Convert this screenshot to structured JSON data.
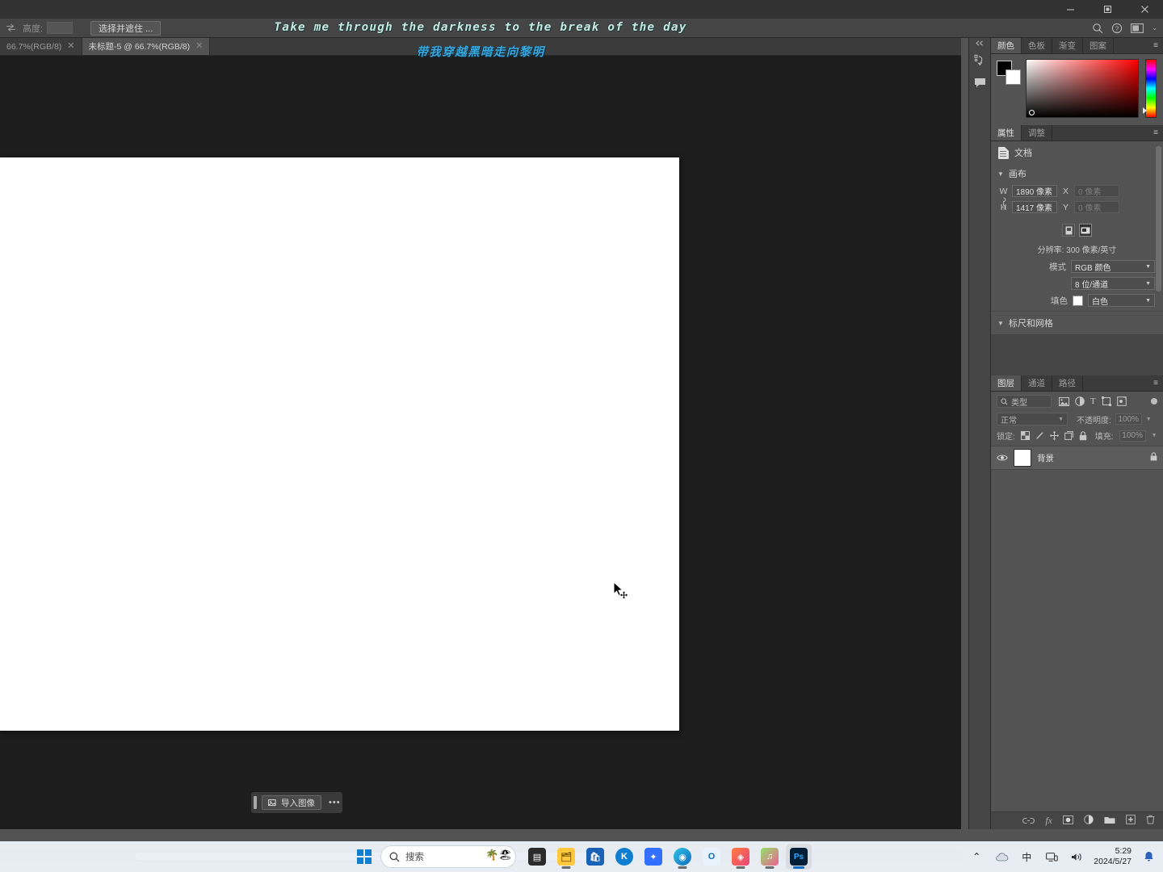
{
  "window": {
    "minimize": "–",
    "restore": "❐",
    "close": "✕"
  },
  "options_bar": {
    "swap_icon": "swap-arrows-icon",
    "height_label": "高度:",
    "height_value": "",
    "select_and_mask": "选择并遮住 ...",
    "search_icon": "search-icon",
    "help_icon": "help-icon",
    "workspace_icon": "workspace-icon",
    "chevron": "⌄"
  },
  "lyrics": {
    "english": "Take me through the darkness to the break of the day",
    "chinese": "带我穿越黑暗走向黎明"
  },
  "tabs": [
    {
      "label": "66.7%(RGB/8)",
      "close": "✕",
      "active": false
    },
    {
      "label": "未标题-5 @ 66.7%(RGB/8)",
      "close": "✕",
      "active": true
    }
  ],
  "canvas": {
    "import_button": "导入图像",
    "import_more": "•••",
    "import_icon": "import-image-icon"
  },
  "rail": {
    "collapse": "◀◀",
    "icons": [
      "history-icon",
      "comment-icon"
    ]
  },
  "color_panel": {
    "tabs": [
      "颜色",
      "色板",
      "渐变",
      "图案"
    ],
    "active_tab": "颜色",
    "menu": "≡",
    "foreground": "#000000",
    "background": "#ffffff"
  },
  "properties_panel": {
    "tabs": [
      "属性",
      "调整"
    ],
    "active_tab": "属性",
    "menu": "≡",
    "doc_label": "文档",
    "canvas_section": "画布",
    "w_label": "W",
    "w_value": "1890 像素",
    "x_label": "X",
    "x_value": "0 像素",
    "h_label": "H",
    "h_value": "1417 像素",
    "y_label": "Y",
    "y_value": "0 像素",
    "resolution": "分辨率: 300 像素/英寸",
    "mode_label": "模式",
    "mode_value": "RGB 颜色",
    "depth_value": "8 位/通道",
    "fill_label": "填色",
    "fill_value": "白色",
    "fill_color": "#ffffff",
    "rulers_section": "标尺和网格"
  },
  "layers_panel": {
    "tabs": [
      "图层",
      "通道",
      "路径"
    ],
    "active_tab": "图层",
    "menu": "≡",
    "filter_kind": "类型",
    "filter_icons": [
      "pixel-filter-icon",
      "adjustment-filter-icon",
      "type-filter-icon",
      "shape-filter-icon",
      "smartobject-filter-icon"
    ],
    "blend_mode": "正常",
    "opacity_label": "不透明度:",
    "opacity_value": "100%",
    "lock_label": "锁定:",
    "fill_label": "填充:",
    "fill_value": "100%",
    "layers": [
      {
        "name": "背景",
        "visible": true,
        "locked": true,
        "thumb_color": "#ffffff"
      }
    ],
    "footer_icons": [
      "link-icon",
      "fx-icon",
      "mask-icon",
      "adjustment-icon",
      "group-icon",
      "new-layer-icon",
      "delete-icon"
    ]
  },
  "taskbar": {
    "start_icon": "windows-start-icon",
    "search_placeholder": "搜索",
    "search_icon": "search-icon",
    "apps": [
      {
        "name": "task-view",
        "glyph": "▤",
        "color": "#2b2b2b",
        "running": false
      },
      {
        "name": "file-explorer",
        "glyph": "📁",
        "color": "#ffc83d",
        "running": true
      },
      {
        "name": "microsoft-store",
        "glyph": "🛍",
        "color": "#1a62b5",
        "running": false
      },
      {
        "name": "kingsoft-wps",
        "glyph": "Ⓚ",
        "color": "#0f7ed0",
        "running": false
      },
      {
        "name": "feishu",
        "glyph": "✦",
        "color": "#3370ff",
        "running": false
      },
      {
        "name": "microsoft-edge",
        "glyph": "◉",
        "color": "#0f94d6",
        "running": true
      },
      {
        "name": "outlook",
        "glyph": "O",
        "color": "#0f6cbd",
        "running": false
      },
      {
        "name": "creative-cloud",
        "glyph": "◈",
        "color": "#e8467c",
        "running": true
      },
      {
        "name": "douyin",
        "glyph": "♫",
        "color": "#f06292",
        "running": true
      },
      {
        "name": "photoshop",
        "glyph": "Ps",
        "color": "#001e36",
        "running": true
      }
    ],
    "tray": {
      "overflow": "⌃",
      "cloud_icon": "onedrive-icon",
      "ime": "中",
      "network_icon": "network-icon",
      "volume_icon": "volume-icon",
      "time": "5:29",
      "date": "2024/5/27",
      "notification_icon": "bell-icon"
    }
  },
  "cursor": {
    "type": "move-cursor"
  }
}
